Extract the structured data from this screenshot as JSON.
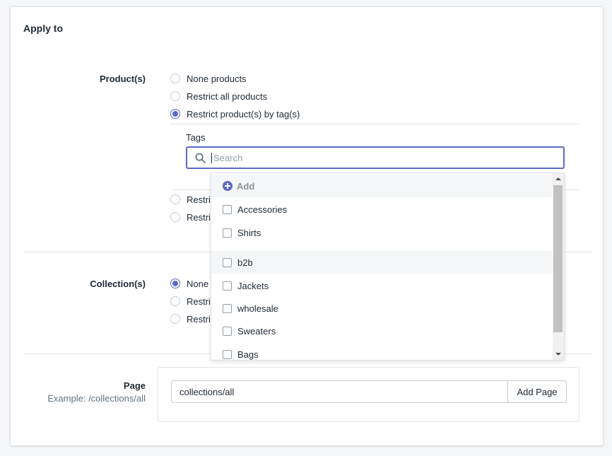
{
  "card": {
    "title": "Apply to"
  },
  "products": {
    "label": "Product(s)",
    "options": [
      {
        "label": "None products",
        "checked": false
      },
      {
        "label": "Restrict all products",
        "checked": false
      },
      {
        "label": "Restrict product(s) by tag(s)",
        "checked": true
      },
      {
        "label": "Restric",
        "checked": false
      },
      {
        "label": "Restric",
        "checked": false
      }
    ]
  },
  "tags": {
    "label": "Tags",
    "search_placeholder": "Search",
    "add_label": "Add",
    "items": [
      "Accessories",
      "Shirts",
      "b2b",
      "Jackets",
      "wholesale",
      "Sweaters",
      "Bags"
    ]
  },
  "collections": {
    "label": "Collection(s)",
    "options": [
      {
        "label": "None c",
        "checked": true
      },
      {
        "label": "Restric",
        "checked": false
      },
      {
        "label": "Restric",
        "checked": false
      }
    ]
  },
  "page": {
    "label": "Page",
    "example": "Example: /collections/all",
    "input_value": "collections/all",
    "button_label": "Add Page"
  },
  "colors": {
    "accent": "#5c6ac4",
    "border": "#dfe3e8",
    "text": "#212b36",
    "muted": "#637381"
  }
}
